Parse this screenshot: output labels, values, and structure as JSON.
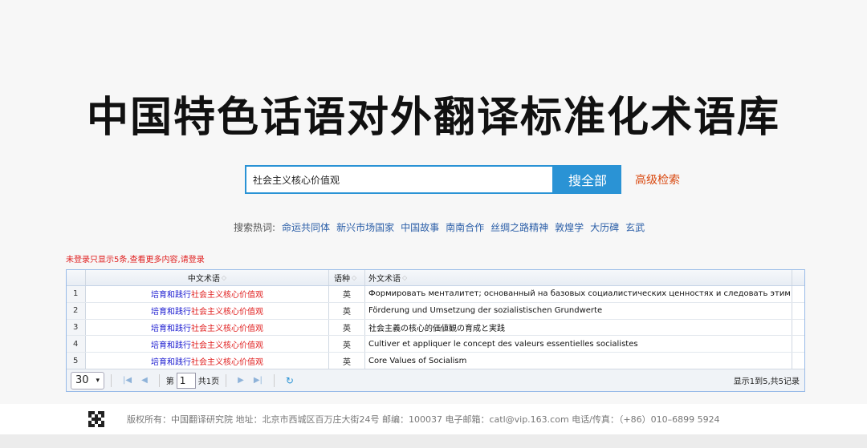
{
  "title": "中国特色话语对外翻译标准化术语库",
  "search": {
    "value": "社会主义核心价值观",
    "button_label": "搜全部",
    "advanced_label": "高级检索"
  },
  "hot_search": {
    "label": "搜索热词:",
    "items": [
      "命运共同体",
      "新兴市场国家",
      "中国故事",
      "南南合作",
      "丝绸之路精神",
      "敦煌学",
      "大历碑",
      "玄武"
    ]
  },
  "notice": "未登录只显示5条,查看更多内容,请登录",
  "grid": {
    "headers": {
      "chinese": "中文术语",
      "language": "语种",
      "foreign": "外文术语"
    },
    "rows": [
      {
        "num": "1",
        "cn_prefix": "培育和践行",
        "cn_highlight": "社会主义核心价值观",
        "lang": "英",
        "foreign": "Формировать менталитет; основанный на базовых социалистических ценностях и следовать этим ценностям"
      },
      {
        "num": "2",
        "cn_prefix": "培育和践行",
        "cn_highlight": "社会主义核心价值观",
        "lang": "英",
        "foreign": "Förderung und Umsetzung der sozialistischen Grundwerte"
      },
      {
        "num": "3",
        "cn_prefix": "培育和践行",
        "cn_highlight": "社会主义核心价值观",
        "lang": "英",
        "foreign": "社会主義の核心的価値観の育成と実践"
      },
      {
        "num": "4",
        "cn_prefix": "培育和践行",
        "cn_highlight": "社会主义核心价值观",
        "lang": "英",
        "foreign": "Cultiver et appliquer le concept des valeurs essentielles socialistes"
      },
      {
        "num": "5",
        "cn_prefix": "培育和践行",
        "cn_highlight": "社会主义核心价值观",
        "lang": "英",
        "foreign": "Core Values of Socialism"
      }
    ]
  },
  "pager": {
    "page_size": "30",
    "page_prefix": "第",
    "page_value": "1",
    "page_total": "共1页",
    "info": "显示1到5,共5记录"
  },
  "footer": "版权所有：中国翻译研究院 地址：北京市西城区百万庄大街24号 邮编：100037 电子邮箱：catl@vip.163.com 电话/传真：（+86）010–6899 5924",
  "colors": {
    "accent": "#2a93d5",
    "highlight": "#e02020",
    "link": "#1a1ad0"
  }
}
